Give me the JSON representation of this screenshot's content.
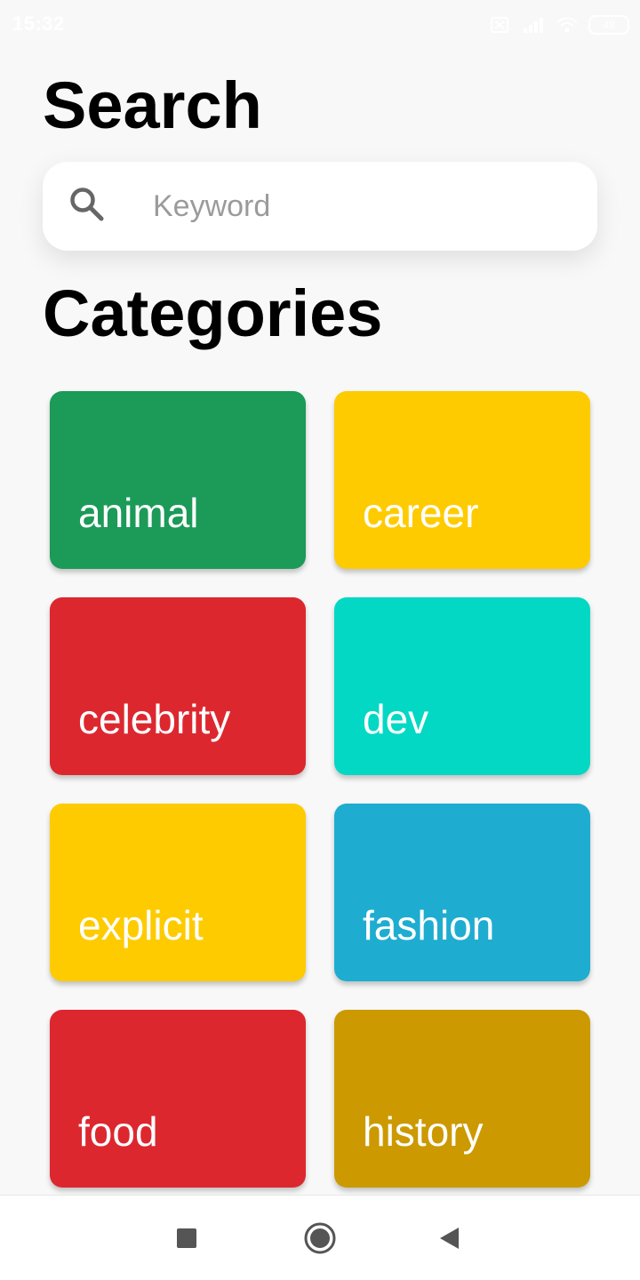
{
  "status_bar": {
    "time": "15:32",
    "battery": "48"
  },
  "header": {
    "title": "Search"
  },
  "search": {
    "value": "",
    "placeholder": "Keyword",
    "icon": "search-icon"
  },
  "categories": {
    "title": "Categories",
    "items": [
      {
        "label": "animal",
        "color": "#1b9a58"
      },
      {
        "label": "career",
        "color": "#fecb00"
      },
      {
        "label": "celebrity",
        "color": "#dd272f"
      },
      {
        "label": "dev",
        "color": "#03d8c4"
      },
      {
        "label": "explicit",
        "color": "#fecb00"
      },
      {
        "label": "fashion",
        "color": "#1eadd0"
      },
      {
        "label": "food",
        "color": "#dd272f"
      },
      {
        "label": "history",
        "color": "#cc9900"
      }
    ]
  },
  "nav_bar": {
    "icons": [
      "recents-icon",
      "home-icon",
      "back-icon"
    ]
  }
}
